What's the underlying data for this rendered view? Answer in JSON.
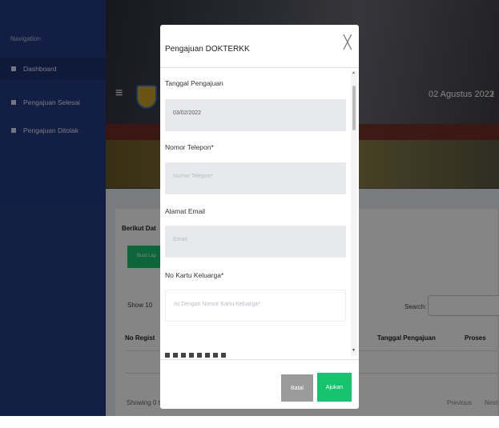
{
  "sidebar": {
    "heading": "Navigation",
    "items": [
      {
        "label": "Dashboard"
      },
      {
        "label": "Pengajuan Selesai"
      },
      {
        "label": "Pengajuan Ditolak"
      }
    ]
  },
  "header": {
    "date": "02 Agustus 2022"
  },
  "main": {
    "intro_text": "Berikut Dat",
    "primary_button_label": "Buat Lap",
    "show_label": "Show",
    "show_value": "10",
    "search_label": "Search:",
    "table_headers": [
      "No Regist",
      "Tanggal Pengajuan",
      "Proses"
    ],
    "showing_text": "Showing 0 t",
    "pagination": {
      "previous": "Previous",
      "next": "Next"
    }
  },
  "modal": {
    "title": "Pengajuan DOKTERKK",
    "close_icon": "close-icon",
    "fields": [
      {
        "label": "Tanggal Pengajuan",
        "value": "03/02/2022",
        "placeholder": ""
      },
      {
        "label": "Nomor Telepon*",
        "value": "",
        "placeholder": "Nomor Telepon*"
      },
      {
        "label": "Alamat Email",
        "value": "",
        "placeholder": "Email"
      },
      {
        "label": "No Kartu Keluarga*",
        "value": "",
        "placeholder": "Isi Dengan Nomor Kartu Keluarga*"
      }
    ],
    "cancel_label": "Batal",
    "submit_label": "Ajukan"
  },
  "colors": {
    "sidebar": "#243b80",
    "accent_green": "#17c36f",
    "overlay": "rgba(0,0,0,0.48)"
  }
}
